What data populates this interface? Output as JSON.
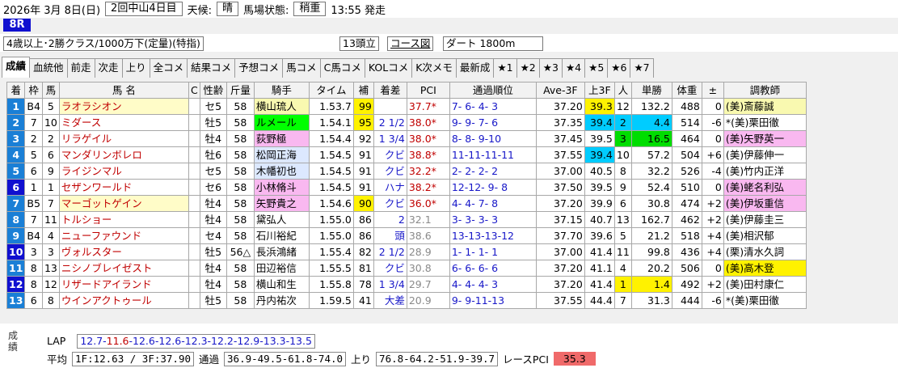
{
  "header": {
    "date": "2026年 3月 8日(日)",
    "meeting": "2回中山4日目",
    "weather_label": "天候:",
    "weather": "晴",
    "track_label": "馬場状態:",
    "track": "稍重",
    "post_time": "13:55 発走"
  },
  "race": {
    "number": "8R",
    "condition": "4歳以上･2勝クラス/1000万下(定量)(特指)",
    "runners": "13頭立",
    "course_map": "コース図",
    "course": "ダート 1800m"
  },
  "tabs": [
    "成績",
    "血統他",
    "前走",
    "次走",
    "上り",
    "全コメ",
    "結果コメ",
    "予想コメ",
    "馬コメ",
    "C馬コメ",
    "KOLコメ",
    "K次メモ",
    "最新成",
    "★1",
    "★2",
    "★3",
    "★4",
    "★5",
    "★6",
    "★7"
  ],
  "columns": [
    "着",
    "枠",
    "馬",
    "馬 名",
    "C",
    "性齢",
    "斤量",
    "騎手",
    "タイム",
    "補",
    "着差",
    "PCI",
    "通過順位",
    "Ave-3F",
    "上3F",
    "人",
    "単勝",
    "体重",
    "±",
    "調教師"
  ],
  "rows": [
    {
      "finish": "1",
      "color": "#1a7fd6",
      "frame": "B4",
      "num": "5",
      "name": "ラオラシオン",
      "sex": "セ5",
      "weight": "58",
      "jockey": "横山琉人",
      "jbg": "#f9f9b0",
      "time": "1.53.7",
      "adj": "99",
      "adjbg": "#fff200",
      "margin": "",
      "pci": "37.7*",
      "pcis": "l",
      "pass": "7- 6- 4- 3",
      "ave": "37.20",
      "last": "39.3",
      "lastbg": "#fff200",
      "pop": "12",
      "odds": "132.2",
      "oddsbg": "",
      "bw": "488",
      "diff": "0",
      "trainer": "(美)斎藤誠",
      "tbg": "#f9f9b0",
      "trow": "#fffcc8"
    },
    {
      "finish": "2",
      "color": "#1a7fd6",
      "frame": "7",
      "num": "10",
      "name": "ミダース",
      "sex": "牡5",
      "weight": "58",
      "jockey": "ルメール",
      "jbg": "#00ff00",
      "time": "1.54.1",
      "adj": "95",
      "adjbg": "#fff200",
      "margin": "2 1/2",
      "pci": "38.0*",
      "pcis": "l",
      "pass": "9- 9- 7- 6",
      "ave": "37.35",
      "last": "39.4",
      "lastbg": "#00ccff",
      "pop": "2",
      "odds": "4.4",
      "oddsbg": "#00ccff",
      "bw": "514",
      "diff": "-6",
      "trainer": "*(美)栗田徹",
      "tbg": "",
      "trow": ""
    },
    {
      "finish": "3",
      "color": "#1a7fd6",
      "frame": "2",
      "num": "2",
      "name": "リラゲイル",
      "sex": "牡4",
      "weight": "58",
      "jockey": "荻野極",
      "jbg": "#f9b8f0",
      "time": "1.54.4",
      "adj": "92",
      "adjbg": "",
      "margin": "1 3/4",
      "pci": "38.0*",
      "pcis": "l",
      "pass": "8- 8- 9-10",
      "ave": "37.45",
      "last": "39.5",
      "lastbg": "",
      "pop": "3",
      "odds": "16.5",
      "oddsbg": "#00dd00",
      "bw": "464",
      "diff": "0",
      "trainer": "(美)矢野英一",
      "tbg": "#f9b8f0",
      "trow": ""
    },
    {
      "finish": "4",
      "color": "#1a7fd6",
      "frame": "5",
      "num": "6",
      "name": "マンダリンボレロ",
      "sex": "牡6",
      "weight": "58",
      "jockey": "松岡正海",
      "jbg": "#dce8ff",
      "time": "1.54.5",
      "adj": "91",
      "adjbg": "",
      "margin": "クビ",
      "pci": "38.8*",
      "pcis": "l",
      "pass": "11-11-11-11",
      "ave": "37.55",
      "last": "39.4",
      "lastbg": "#00ccff",
      "pop": "10",
      "odds": "57.2",
      "oddsbg": "",
      "bw": "504",
      "diff": "+6",
      "trainer": "(美)伊藤伸一",
      "tbg": "",
      "trow": ""
    },
    {
      "finish": "5",
      "color": "#1a7fd6",
      "frame": "6",
      "num": "9",
      "name": "ライジンマル",
      "sex": "セ5",
      "weight": "58",
      "jockey": "木幡初也",
      "jbg": "#dce8ff",
      "time": "1.54.5",
      "adj": "91",
      "adjbg": "",
      "margin": "クビ",
      "pci": "32.2*",
      "pcis": "l",
      "pass": "2- 2- 2- 2",
      "ave": "37.00",
      "last": "40.5",
      "lastbg": "",
      "pop": "8",
      "odds": "32.2",
      "oddsbg": "",
      "bw": "526",
      "diff": "-4",
      "trainer": "(美)竹内正洋",
      "tbg": "",
      "trow": ""
    },
    {
      "finish": "6",
      "color": "#1010d0",
      "frame": "1",
      "num": "1",
      "name": "セザンワールド",
      "sex": "セ6",
      "weight": "58",
      "jockey": "小林脩斗",
      "jbg": "#f9b8f0",
      "time": "1.54.5",
      "adj": "91",
      "adjbg": "",
      "margin": "ハナ",
      "pci": "38.2*",
      "pcis": "l",
      "pass": "12-12- 9- 8",
      "ave": "37.50",
      "last": "39.5",
      "lastbg": "",
      "pop": "9",
      "odds": "52.4",
      "oddsbg": "",
      "bw": "510",
      "diff": "0",
      "trainer": "(美)蛯名利弘",
      "tbg": "#f9b8f0",
      "trow": ""
    },
    {
      "finish": "7",
      "color": "#1a7fd6",
      "frame": "B5",
      "num": "7",
      "name": "マーゴットゲイン",
      "sex": "牡4",
      "weight": "58",
      "jockey": "矢野貴之",
      "jbg": "#f9b8f0",
      "time": "1.54.6",
      "adj": "90",
      "adjbg": "#fff200",
      "margin": "クビ",
      "pci": "36.0*",
      "pcis": "l",
      "pass": "4- 4- 7- 8",
      "ave": "37.20",
      "last": "39.9",
      "lastbg": "",
      "pop": "6",
      "odds": "30.8",
      "oddsbg": "",
      "bw": "474",
      "diff": "+2",
      "trainer": "(美)伊坂重信",
      "tbg": "#f9b8f0",
      "trow": "#fffcc8"
    },
    {
      "finish": "8",
      "color": "#1a7fd6",
      "frame": "7",
      "num": "11",
      "name": "トルショー",
      "sex": "牡4",
      "weight": "58",
      "jockey": "黛弘人",
      "jbg": "",
      "time": "1.55.0",
      "adj": "86",
      "adjbg": "",
      "margin": "2",
      "pci": "32.1",
      "pcis": "g",
      "pass": "3- 3- 3- 3",
      "ave": "37.15",
      "last": "40.7",
      "lastbg": "",
      "pop": "13",
      "odds": "162.7",
      "oddsbg": "",
      "bw": "462",
      "diff": "+2",
      "trainer": "(美)伊藤圭三",
      "tbg": "",
      "trow": ""
    },
    {
      "finish": "9",
      "color": "#1a7fd6",
      "frame": "B4",
      "num": "4",
      "name": "ニューファウンド",
      "sex": "セ4",
      "weight": "58",
      "jockey": "石川裕紀",
      "jbg": "",
      "time": "1.55.0",
      "adj": "86",
      "adjbg": "",
      "margin": "頭",
      "pci": "38.6",
      "pcis": "g",
      "pass": "13-13-13-12",
      "ave": "37.70",
      "last": "39.6",
      "lastbg": "",
      "pop": "5",
      "odds": "21.2",
      "oddsbg": "",
      "bw": "518",
      "diff": "+4",
      "trainer": "(美)相沢郁",
      "tbg": "",
      "trow": ""
    },
    {
      "finish": "10",
      "color": "#1010d0",
      "frame": "3",
      "num": "3",
      "name": "ヴォルスター",
      "sex": "牡5",
      "weight": "56△",
      "jockey": "長浜鴻緒",
      "jbg": "",
      "time": "1.55.4",
      "adj": "82",
      "adjbg": "",
      "margin": "2 1/2",
      "pci": "28.9",
      "pcis": "g",
      "pass": "1- 1- 1- 1",
      "ave": "37.00",
      "last": "41.4",
      "lastbg": "",
      "pop": "11",
      "odds": "99.8",
      "oddsbg": "",
      "bw": "436",
      "diff": "+4",
      "trainer": "(栗)清水久詞",
      "tbg": "",
      "trow": ""
    },
    {
      "finish": "11",
      "color": "#1a7fd6",
      "frame": "8",
      "num": "13",
      "name": "ニシノブレイゼスト",
      "sex": "牡4",
      "weight": "58",
      "jockey": "田辺裕信",
      "jbg": "",
      "time": "1.55.5",
      "adj": "81",
      "adjbg": "",
      "margin": "クビ",
      "pci": "30.8",
      "pcis": "g",
      "pass": "6- 6- 6- 6",
      "ave": "37.20",
      "last": "41.1",
      "lastbg": "",
      "pop": "4",
      "odds": "20.2",
      "oddsbg": "",
      "bw": "506",
      "diff": "0",
      "trainer": "(美)高木登",
      "tbg": "#fff200",
      "trow": ""
    },
    {
      "finish": "12",
      "color": "#1010d0",
      "frame": "8",
      "num": "12",
      "name": "リザードアイランド",
      "sex": "牡4",
      "weight": "58",
      "jockey": "横山和生",
      "jbg": "",
      "time": "1.55.8",
      "adj": "78",
      "adjbg": "",
      "margin": "1 3/4",
      "pci": "29.7",
      "pcis": "g",
      "pass": "4- 4- 4- 3",
      "ave": "37.20",
      "last": "41.4",
      "lastbg": "",
      "pop": "1",
      "odds": "1.4",
      "oddsbg": "#fff200",
      "popbg": "#fff200",
      "bw": "492",
      "diff": "+2",
      "trainer": "(美)田村康仁",
      "tbg": "",
      "trow": ""
    },
    {
      "finish": "13",
      "color": "#1a7fd6",
      "frame": "6",
      "num": "8",
      "name": "ウインアクトゥール",
      "sex": "牡5",
      "weight": "58",
      "jockey": "丹内祐次",
      "jbg": "",
      "time": "1.59.5",
      "adj": "41",
      "adjbg": "",
      "margin": "大差",
      "pci": "20.9",
      "pcis": "g",
      "pass": "9- 9-11-13",
      "ave": "37.55",
      "last": "44.4",
      "lastbg": "",
      "pop": "7",
      "odds": "31.3",
      "oddsbg": "",
      "bw": "444",
      "diff": "-6",
      "trainer": "*(美)栗田徹",
      "tbg": "",
      "trow": ""
    }
  ],
  "footer": {
    "side_label": "成績",
    "lap_label": "LAP",
    "lap_part1": "12.7-",
    "lap_part2": "11.6",
    "lap_part3": "-12.6-12.6-12.3-12.2-12.9-13.3-13.5",
    "avg_label": "平均",
    "avg_value": "1F:12.63 / 3F:37.90",
    "pass_label": "通過",
    "pass_value": "36.9-49.5-61.8-74.0",
    "up_label": "上り",
    "up_value": "76.8-64.2-51.9-39.7",
    "pci_label": "レースPCI",
    "pci_value": "35.3"
  }
}
